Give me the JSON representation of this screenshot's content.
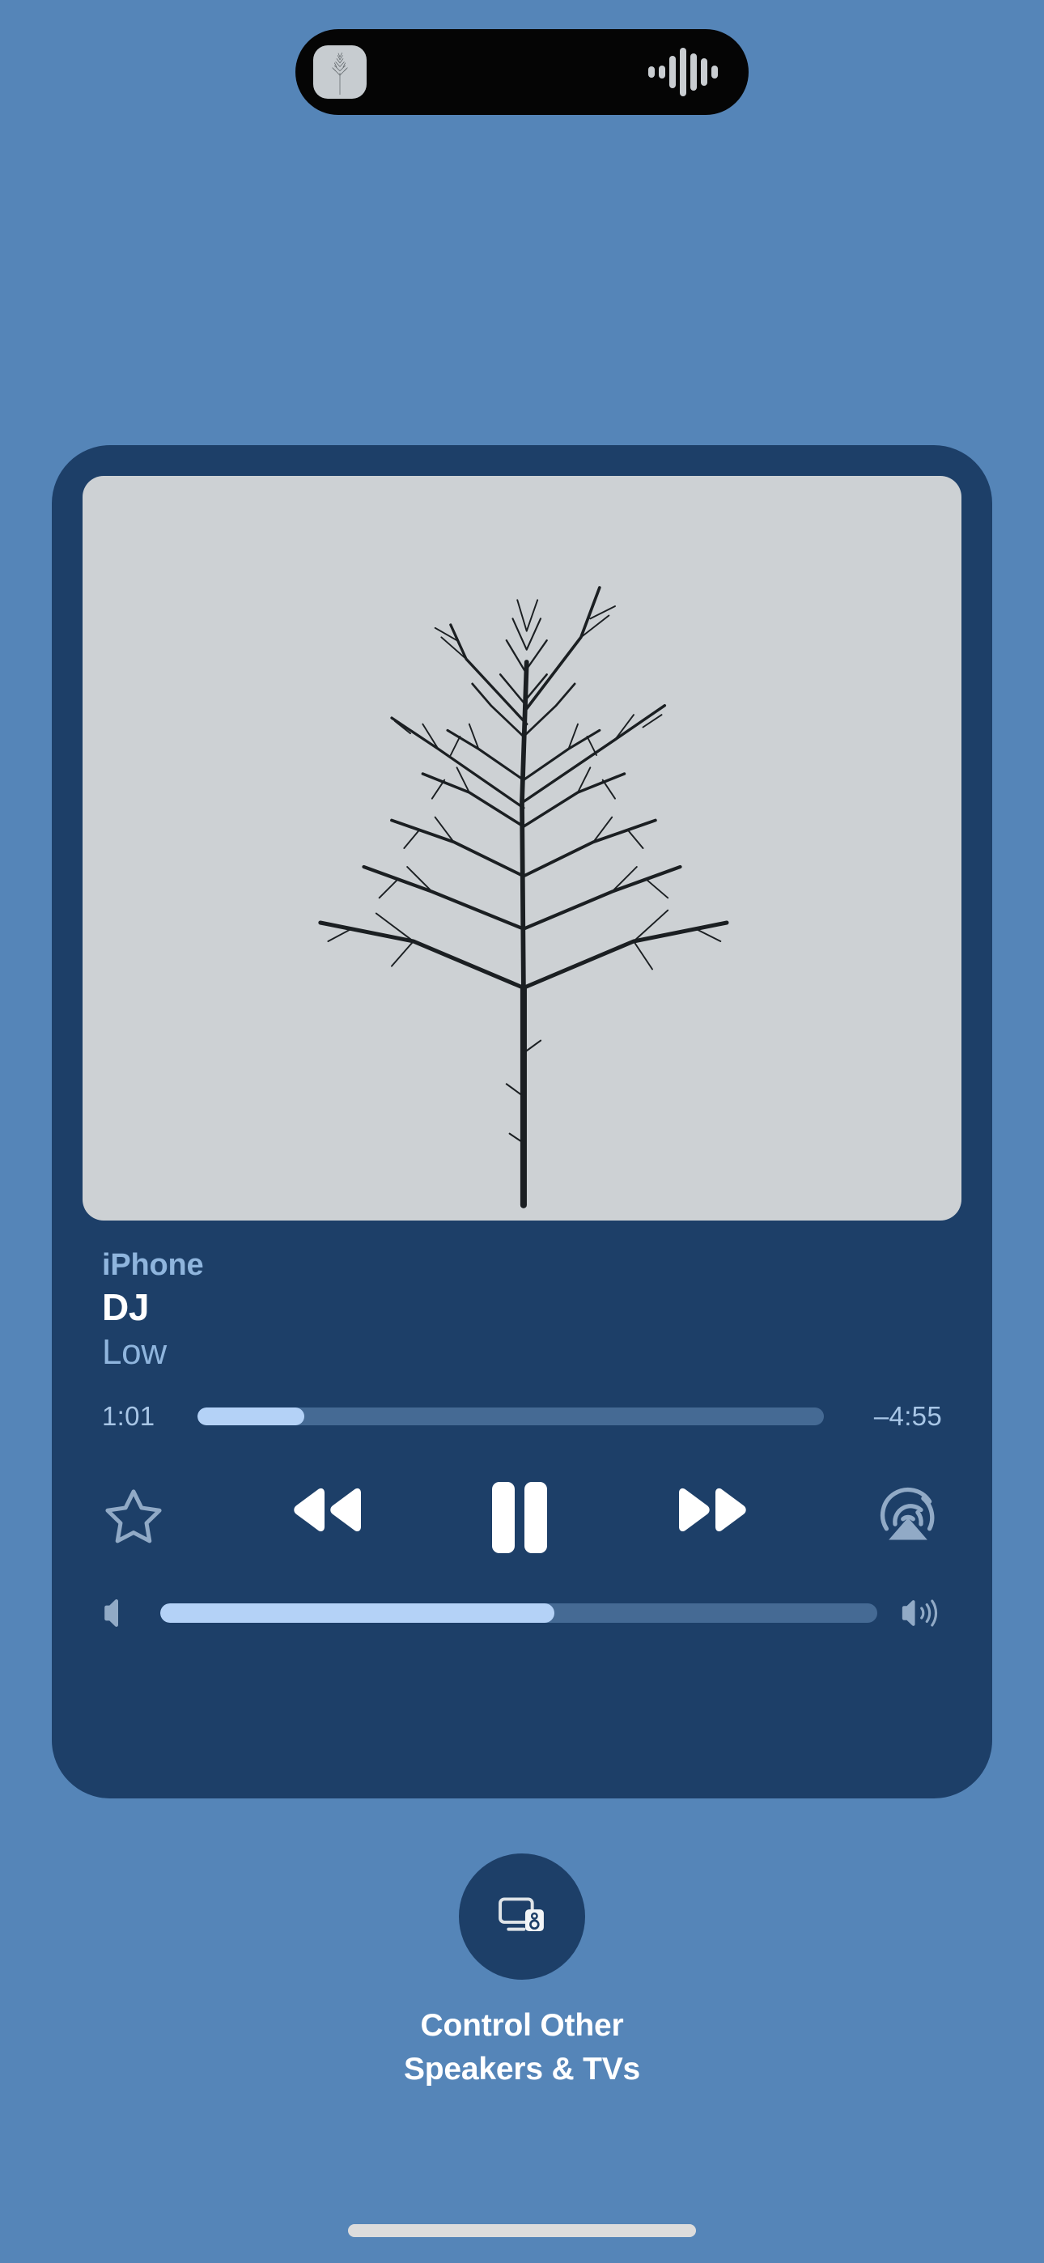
{
  "theme": {
    "background": "#5585b8",
    "card_background": "#1d3f68",
    "accent_fill": "#b4d2f7",
    "track_color": "#456a94",
    "secondary_text": "#8fb5dd",
    "primary_text": "#ffffff",
    "island_background": "#050505",
    "artwork_background": "#cdd1d4",
    "icon_muted": "#91aac6",
    "home_indicator": "#dcdcdc"
  },
  "dynamic_island": {
    "left_icon": "album-artwork-thumbnail",
    "right_icon": "audio-waveform-icon",
    "waveform_bars": [
      14,
      16,
      40,
      60,
      46,
      34,
      16
    ]
  },
  "now_playing": {
    "artwork_alt": "bare-tree-album-artwork",
    "route_label": "iPhone",
    "title": "DJ",
    "artist": "Low",
    "progress": {
      "elapsed": "1:01",
      "remaining": "–4:55",
      "percent": 17
    },
    "volume": {
      "percent": 55,
      "min_icon": "speaker-low-icon",
      "max_icon": "speaker-high-icon"
    },
    "controls": [
      {
        "name": "favorite-button",
        "icon": "star-outline-icon",
        "state": "off"
      },
      {
        "name": "rewind-button",
        "icon": "rewind-icon",
        "state": "enabled"
      },
      {
        "name": "play-pause-button",
        "icon": "pause-icon",
        "state": "playing"
      },
      {
        "name": "fast-forward-button",
        "icon": "fast-forward-icon",
        "state": "enabled"
      },
      {
        "name": "airplay-button",
        "icon": "airplay-audio-icon",
        "state": "enabled"
      }
    ]
  },
  "bottom_action": {
    "icon": "tv-and-speaker-icon",
    "label": "Control Other\nSpeakers & TVs",
    "label_line1": "Control Other",
    "label_line2": "Speakers & TVs"
  },
  "home_indicator": {
    "visible": true
  }
}
